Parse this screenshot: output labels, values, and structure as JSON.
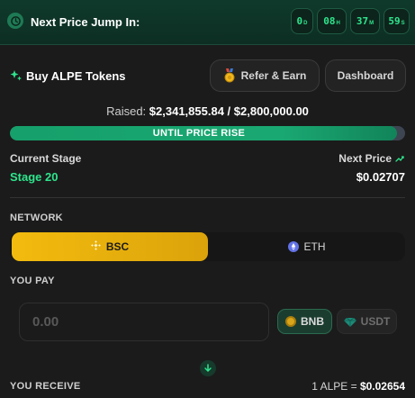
{
  "header": {
    "label": "Next Price Jump In:",
    "timer": [
      {
        "value": "0",
        "unit": "D"
      },
      {
        "value": "08",
        "unit": "H"
      },
      {
        "value": "37",
        "unit": "M"
      },
      {
        "value": "59",
        "unit": "S"
      }
    ]
  },
  "buy": {
    "title": "Buy ALPE Tokens",
    "refer_label": "Refer & Earn",
    "dashboard_label": "Dashboard"
  },
  "raised": {
    "prefix": "Raised:",
    "amount": "$2,341,855.84 / $2,800,000.00",
    "progress_fraction": 0.98,
    "progress_label": "UNTIL PRICE RISE"
  },
  "stage": {
    "label": "Current Stage",
    "value": "Stage 20",
    "next_label": "Next Price",
    "next_value": "$0.02707"
  },
  "network": {
    "label": "NETWORK",
    "options": [
      "BSC",
      "ETH"
    ],
    "selected": "BSC"
  },
  "pay": {
    "label": "YOU PAY",
    "placeholder": "0.00",
    "tokens": [
      "BNB",
      "USDT"
    ],
    "selected_token": "BNB"
  },
  "receive": {
    "label": "YOU RECEIVE",
    "rate_prefix": "1 ALPE =",
    "rate_value": "$0.02654"
  },
  "colors": {
    "accent_green": "#2ee58d",
    "bsc_yellow": "#f3bb0e",
    "header_bg": "#0f3a2b",
    "page_bg": "#1b1b1b"
  }
}
